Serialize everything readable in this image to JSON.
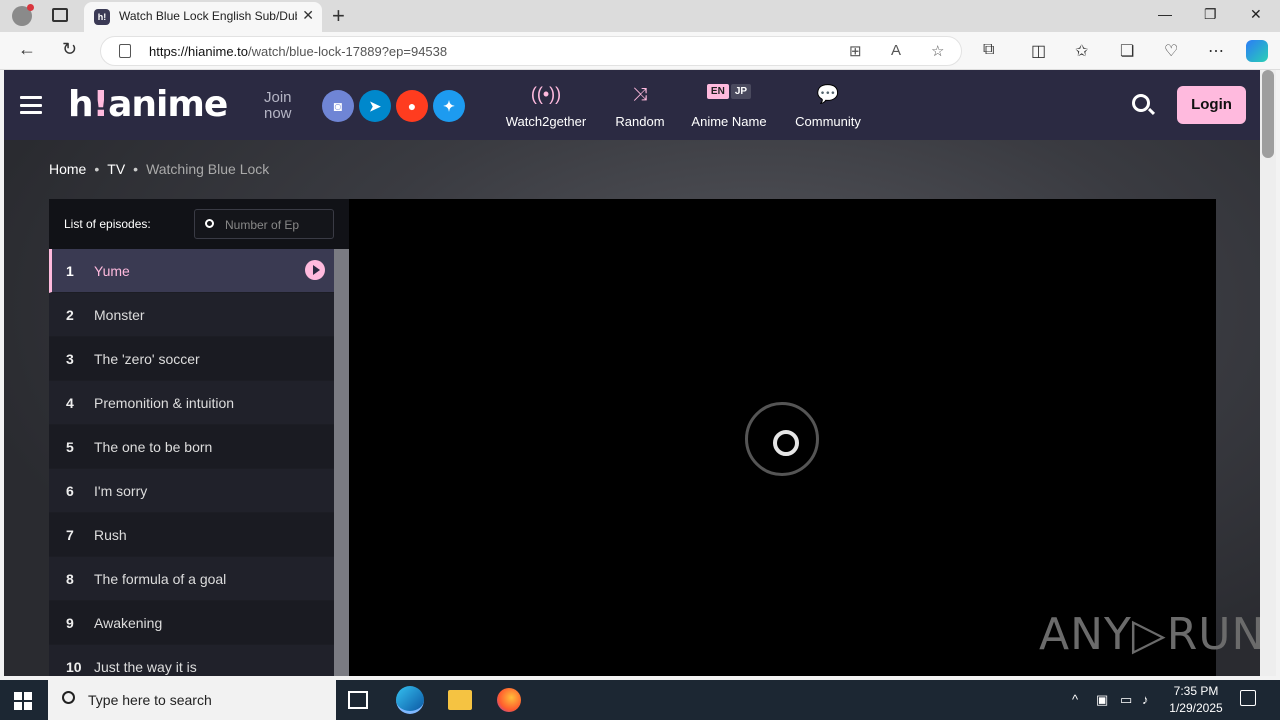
{
  "browser": {
    "tab_title": "Watch Blue Lock English Sub/Dub",
    "tab_favicon": "h!",
    "url_host": "https://hianime.to",
    "url_path": "/watch/blue-lock-17889?ep=94538"
  },
  "site": {
    "logo_main": "h",
    "logo_accent": "!",
    "logo_tail": "anime",
    "join_line1": "Join",
    "join_line2": "now",
    "nav": [
      {
        "label": "Watch2gether",
        "icon": "broadcast-icon"
      },
      {
        "label": "Random",
        "icon": "shuffle-icon"
      },
      {
        "label": "Anime Name",
        "lang_en": "EN",
        "lang_jp": "JP"
      },
      {
        "label": "Community",
        "icon": "chat-icon"
      }
    ],
    "login_label": "Login",
    "accent_color": "#ffbade"
  },
  "breadcrumb": {
    "home": "Home",
    "type": "TV",
    "current": "Watching Blue Lock"
  },
  "episodes": {
    "header_label": "List of episodes:",
    "search_placeholder": "Number of Ep",
    "items": [
      {
        "num": "1",
        "title": "Yume"
      },
      {
        "num": "2",
        "title": "Monster"
      },
      {
        "num": "3",
        "title": "The 'zero' soccer"
      },
      {
        "num": "4",
        "title": "Premonition & intuition"
      },
      {
        "num": "5",
        "title": "The one to be born"
      },
      {
        "num": "6",
        "title": "I'm sorry"
      },
      {
        "num": "7",
        "title": "Rush"
      },
      {
        "num": "8",
        "title": "The formula of a goal"
      },
      {
        "num": "9",
        "title": "Awakening"
      },
      {
        "num": "10",
        "title": "Just the way it is"
      }
    ]
  },
  "watermark": "ANY▷RUN",
  "taskbar": {
    "search_placeholder": "Type here to search",
    "time": "7:35 PM",
    "date": "1/29/2025"
  }
}
